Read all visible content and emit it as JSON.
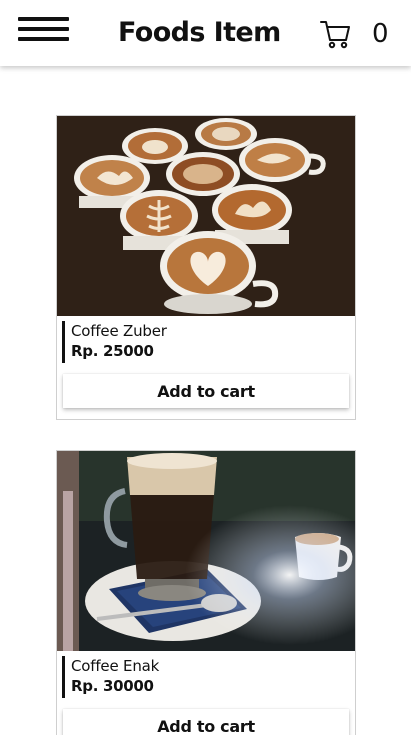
{
  "header": {
    "title": "Foods Item",
    "cart_count": "0",
    "menu_icon": "hamburger-menu-icon",
    "cart_icon": "shopping-cart-icon"
  },
  "products": [
    {
      "name": "Coffee Zuber",
      "price": "Rp. 25000",
      "button_label": "Add to cart",
      "image": "latte-art-cups-photo"
    },
    {
      "name": "Coffee Enak",
      "price": "Rp. 30000",
      "button_label": "Add to cart",
      "image": "coffee-glass-mug-photo"
    }
  ],
  "colors": {
    "text": "#111111",
    "background": "#ffffff",
    "border": "#cfcfcf"
  }
}
